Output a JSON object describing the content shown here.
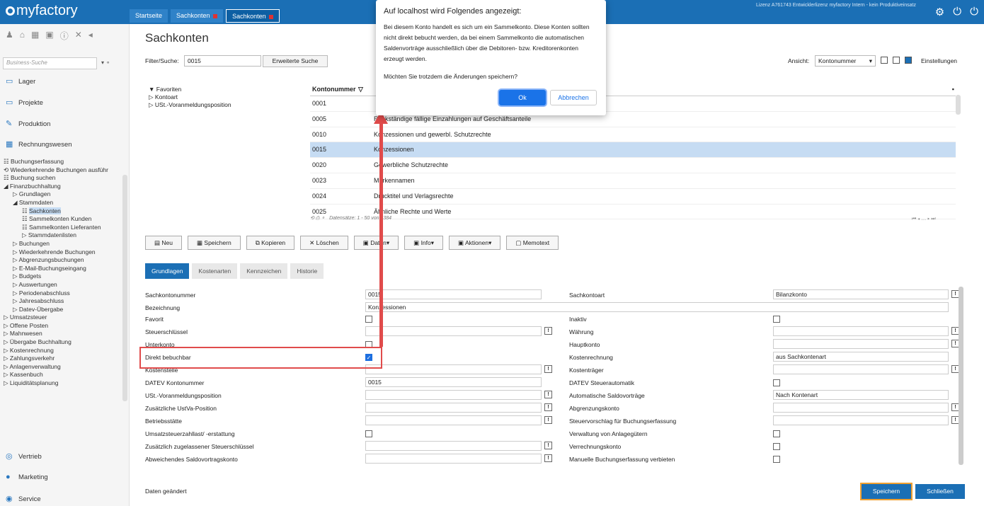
{
  "app": {
    "logo": "myfactory",
    "license": "Lizenz A761743 Entwicklerlizenz myfactory Intern - kein Produktiveinsatz"
  },
  "tabs": [
    {
      "label": "Startseite"
    },
    {
      "label": "Sachkonten"
    },
    {
      "label": "Sachkonten"
    }
  ],
  "sidebar": {
    "search_placeholder": "Business-Suche",
    "sections": {
      "lager": "Lager",
      "projekte": "Projekte",
      "produktion": "Produktion",
      "rechnungswesen": "Rechnungswesen",
      "vertrieb": "Vertrieb",
      "marketing": "Marketing",
      "service": "Service"
    },
    "tree": [
      "Buchungserfassung",
      "Wiederkehrende Buchungen ausführ",
      "Buchung suchen",
      "Finanzbuchhaltung",
      "Grundlagen",
      "Stammdaten",
      "Sachkonten",
      "Sammelkonten Kunden",
      "Sammelkonten Lieferanten",
      "Stammdatenlisten",
      "Buchungen",
      "Wiederkehrende Buchungen",
      "Abgrenzungsbuchungen",
      "E-Mail-Buchungseingang",
      "Budgets",
      "Auswertungen",
      "Periodenabschluss",
      "Jahresabschluss",
      "Datev-Übergabe",
      "Umsatzsteuer",
      "Offene Posten",
      "Mahnwesen",
      "Übergabe Buchhaltung",
      "Kostenrechnung",
      "Zahlungsverkehr",
      "Anlagenverwaltung",
      "Kassenbuch",
      "Liquiditätsplanung"
    ]
  },
  "page": {
    "title": "Sachkonten",
    "filter_label": "Filter/Suche:",
    "filter_value": "0015",
    "extended_search": "Erweiterte Suche",
    "view_label": "Ansicht:",
    "view_value": "Kontonummer",
    "settings": "Einstellungen"
  },
  "favtree": [
    "Favoriten",
    "Kontoart",
    "USt.-Voranmeldungsposition"
  ],
  "grid": {
    "col1": "Kontonummer",
    "rows": [
      {
        "nr": "0001",
        "name": ""
      },
      {
        "nr": "0005",
        "name": "Rückständige fällige Einzahlungen auf Geschäftsanteile"
      },
      {
        "nr": "0010",
        "name": "Konzessionen und gewerbl. Schutzrechte"
      },
      {
        "nr": "0015",
        "name": "Konzessionen"
      },
      {
        "nr": "0020",
        "name": "Gewerbliche Schutzrechte"
      },
      {
        "nr": "0023",
        "name": "Markennamen"
      },
      {
        "nr": "0024",
        "name": "Drucktitel und Verlagsrechte"
      },
      {
        "nr": "0025",
        "name": "Ähnliche Rechte und Werte"
      }
    ],
    "footer": "Datensätze: 1 - 50 von 1384"
  },
  "toolbar": {
    "neu": "Neu",
    "speichern": "Speichern",
    "kopieren": "Kopieren",
    "loeschen": "Löschen",
    "daten": "Daten",
    "info": "Info",
    "aktionen": "Aktionen",
    "memotext": "Memotext"
  },
  "formtabs": [
    "Grundlagen",
    "Kostenarten",
    "Kennzeichen",
    "Historie"
  ],
  "form": {
    "left": [
      "Sachkontonummer",
      "Bezeichnung",
      "Favorit",
      "Steuerschlüssel",
      "Unterkonto",
      "Direkt bebuchbar",
      "Kostenstelle",
      "DATEV Kontonummer",
      "USt.-Voranmeldungsposition",
      "Zusätzliche UstVa-Position",
      "Betriebsstätte",
      "Umsatzsteuerzahllast/ -erstattung",
      "Zusätzlich zugelassener Steuerschlüssel",
      "Abweichendes Saldovortragskonto"
    ],
    "sachkontonummer": "0015",
    "bezeichnung": "Konzessionen",
    "datev": "0015",
    "right": [
      "Sachkontoart",
      "Inaktiv",
      "Währung",
      "Hauptkonto",
      "Kostenrechnung",
      "Kostenträger",
      "DATEV Steuerautomatik",
      "Automatische Saldovorträge",
      "Abgrenzungskonto",
      "Steuervorschlag für Buchungserfassung",
      "Verwaltung von Anlagegütern",
      "Verrechnungskonto",
      "Manuelle Buchungserfassung verbieten"
    ],
    "sachkontoart": "Bilanzkonto",
    "kostenrechnung": "aus Sachkontenart",
    "saldovortraege": "Nach Kontenart"
  },
  "status": "Daten geändert",
  "bottom": {
    "save": "Speichern",
    "close": "Schließen"
  },
  "dialog": {
    "title": "Auf localhost wird Folgendes angezeigt:",
    "message": "Bei diesem Konto handelt es sich um ein Sammelkonto. Diese Konten sollten nicht direkt bebucht werden, da bei einem Sammelkonto die automatischen Saldenvorträge ausschließlich über die Debitoren- bzw. Kreditorenkonten erzeugt werden.",
    "question": "Möchten Sie trotzdem die Änderungen speichern?",
    "ok": "Ok",
    "cancel": "Abbrechen"
  },
  "colors": {
    "brand": "#1b6fb5",
    "highlight": "#e04b4b",
    "selection": "#c6dcf3"
  }
}
